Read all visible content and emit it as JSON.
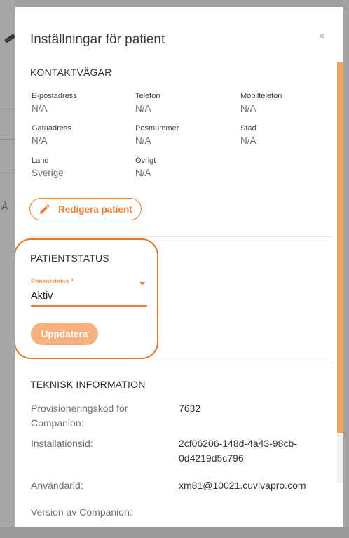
{
  "dialog": {
    "title": "Inställningar för patient",
    "close_glyph": "×"
  },
  "contact": {
    "heading": "KONTAKTVÄGAR",
    "fields": [
      {
        "label": "E-postadress",
        "value": "N/A"
      },
      {
        "label": "Telefon",
        "value": "N/A"
      },
      {
        "label": "Mobiltelefon",
        "value": "N/A"
      },
      {
        "label": "Gatuadress",
        "value": "N/A"
      },
      {
        "label": "Postnummer",
        "value": "N/A"
      },
      {
        "label": "Stad",
        "value": "N/A"
      },
      {
        "label": "Land",
        "value": "Sverige"
      },
      {
        "label": "Övrigt",
        "value": "N/A"
      }
    ],
    "edit_button": {
      "label": "Redigera patient",
      "icon": "pencil-icon"
    }
  },
  "patient_status": {
    "heading": "PATIENTSTATUS",
    "field_label": "Patientstatus *",
    "value": "Aktiv",
    "update_button": "Uppdatera"
  },
  "technical": {
    "heading": "TEKNISK INFORMATION",
    "rows": [
      {
        "key": "Provisioneringskod för Companion:",
        "value": "7632"
      },
      {
        "key": "Installationsid:",
        "value": "2cf06206-148d-4a43-98cb-0d4219d5c796"
      },
      {
        "key": "Användarid:",
        "value": "xm81@10021.cuvivapro.com"
      },
      {
        "key": "Version av Companion:",
        "value": ""
      }
    ]
  },
  "colors": {
    "accent": "#e8813b",
    "accent_light": "#f6b17e",
    "highlight_ring": "#e07a2e"
  }
}
